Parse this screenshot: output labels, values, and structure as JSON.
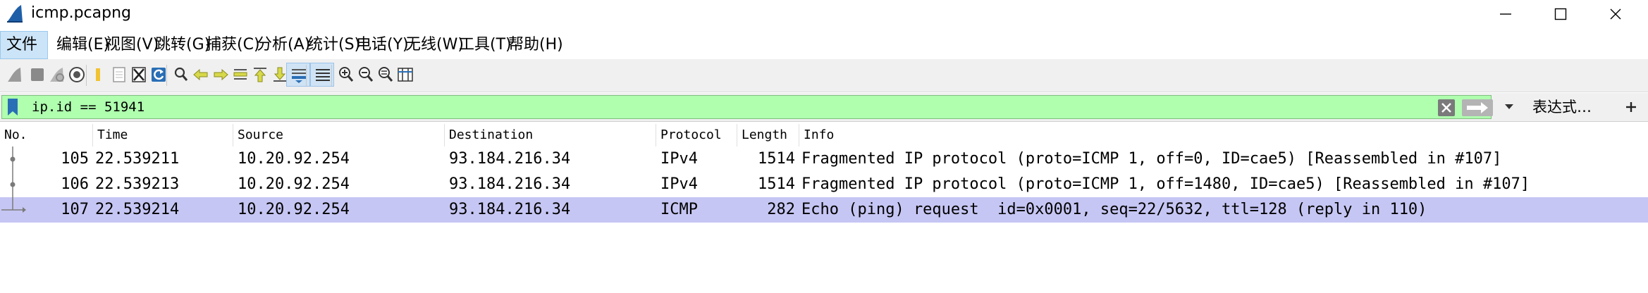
{
  "window": {
    "title": "icmp.pcapng"
  },
  "menu": {
    "items": [
      {
        "label": "文件(F)",
        "active": true
      },
      {
        "label": "编辑(E)"
      },
      {
        "label": "视图(V)"
      },
      {
        "label": "跳转(G)"
      },
      {
        "label": "捕获(C)"
      },
      {
        "label": "分析(A)"
      },
      {
        "label": "统计(S)"
      },
      {
        "label": "电话(Y)"
      },
      {
        "label": "无线(W)"
      },
      {
        "label": "工具(T)"
      },
      {
        "label": "帮助(H)"
      }
    ]
  },
  "toolbar": {
    "icons": [
      "shark-start-icon",
      "stop-icon",
      "restart-icon",
      "capture-options-icon",
      "open-folder-icon",
      "file-icon",
      "close-file-icon",
      "reload-icon",
      "find-icon",
      "go-back-icon",
      "go-forward-icon",
      "go-to-packet-icon",
      "first-packet-icon",
      "last-packet-icon",
      "autoscroll-icon",
      "colorize-icon",
      "zoom-in-icon",
      "zoom-out-icon",
      "zoom-normal-icon",
      "resize-columns-icon"
    ]
  },
  "filter": {
    "value": "ip.id == 51941",
    "background": "#afffaf",
    "expression_label": "表达式…",
    "add_label": "+"
  },
  "packets": {
    "columns": [
      "No.",
      "Time",
      "Source",
      "Destination",
      "Protocol",
      "Length",
      "Info"
    ],
    "rows": [
      {
        "no": "105",
        "time": "22.539211",
        "source": "10.20.92.254",
        "destination": "93.184.216.34",
        "protocol": "IPv4",
        "length": "1514",
        "info": "Fragmented IP protocol (proto=ICMP 1, off=0, ID=cae5) [Reassembled in #107]",
        "selected": false
      },
      {
        "no": "106",
        "time": "22.539213",
        "source": "10.20.92.254",
        "destination": "93.184.216.34",
        "protocol": "IPv4",
        "length": "1514",
        "info": "Fragmented IP protocol (proto=ICMP 1, off=1480, ID=cae5) [Reassembled in #107]",
        "selected": false
      },
      {
        "no": "107",
        "time": "22.539214",
        "source": "10.20.92.254",
        "destination": "93.184.216.34",
        "protocol": "ICMP",
        "length": "282",
        "info": "Echo (ping) request  id=0x0001, seq=22/5632, ttl=128 (reply in 110)",
        "selected": true
      }
    ],
    "selected_color": "#c6c6f4"
  }
}
